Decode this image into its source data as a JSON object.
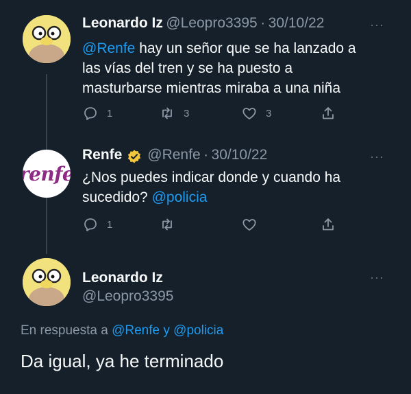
{
  "tweet1": {
    "display_name": "Leonardo Iz",
    "handle": "@Leopro3395",
    "separator": "·",
    "date": "30/10/22",
    "mention": "@Renfe",
    "text_line1": " hay un señor que se ha lanzado a",
    "text_line2": "las vías del tren y se ha puesto a",
    "text_line3": "masturbarse mientras miraba a una niña",
    "replies": "1",
    "retweets": "3",
    "likes": "3",
    "more": "···"
  },
  "tweet2": {
    "display_name": "Renfe",
    "handle": "@Renfe",
    "separator": "·",
    "date": "30/10/22",
    "logo_text": "renfe",
    "text_line1": "¿Nos puedes indicar donde y cuando ha",
    "text_line2_plain": "sucedido? ",
    "text_line2_mention": "@policia",
    "replies": "1",
    "more": "···"
  },
  "tweet3": {
    "display_name": "Leonardo Iz",
    "handle": "@Leopro3395",
    "reply_prefix": "En respuesta a ",
    "reply_to_1": "@Renfe",
    "reply_joiner": " y ",
    "reply_to_2": "@policia",
    "text": "Da igual, ya he terminado",
    "more": "···"
  },
  "colors": {
    "background": "#15202b",
    "link": "#1d9bf0",
    "muted": "#8b98a5",
    "verified": "#f3c63b",
    "renfe_brand": "#8e2b84"
  },
  "icons": [
    "reply-icon",
    "retweet-icon",
    "like-icon",
    "share-icon",
    "verified-badge-icon",
    "more-icon"
  ]
}
